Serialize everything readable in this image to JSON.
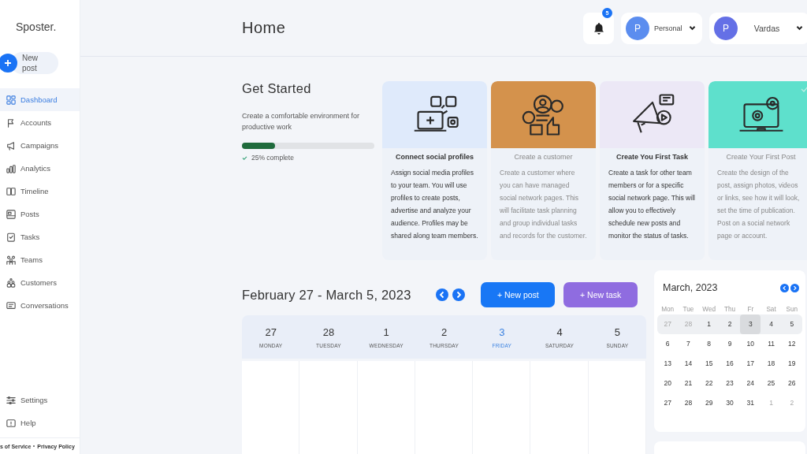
{
  "brand": "Sposter.",
  "new_post": "New post",
  "nav": [
    {
      "label": "Dashboard",
      "selected": true
    },
    {
      "label": "Accounts",
      "selected": false
    },
    {
      "label": "Campaigns",
      "selected": false
    },
    {
      "label": "Analytics",
      "selected": false
    },
    {
      "label": "Timeline",
      "selected": false
    },
    {
      "label": "Posts",
      "selected": false
    },
    {
      "label": "Tasks",
      "selected": false
    },
    {
      "label": "Teams",
      "selected": false
    },
    {
      "label": "Customers",
      "selected": false
    },
    {
      "label": "Conversations",
      "selected": false
    }
  ],
  "nav_bottom": [
    {
      "label": "Settings",
      "selected": false
    },
    {
      "label": "Help",
      "selected": false
    }
  ],
  "footer_links": [
    "s of Service",
    "Privacy Policy"
  ],
  "page_title": "Home",
  "notifications": {
    "count": "5"
  },
  "accounts": [
    {
      "avatar": "P",
      "label": "Personal",
      "color": "#5b8def"
    },
    {
      "avatar": "P",
      "label": "Vardas",
      "color": "#6470e6"
    }
  ],
  "get_started": {
    "title": "Get Started",
    "subtitle": "Create a comfortable environment for productive work",
    "level": 0.25,
    "progress_text": "25% complete"
  },
  "cards": [
    {
      "title": "Connect social profiles",
      "text": "Assign social media profiles to your team. You will use profiles to create posts, advertise and analyze your audience. Profiles may be shared along team members.",
      "color": "#dfeafb",
      "dimmed": false,
      "checked": false
    },
    {
      "title": "Create a customer",
      "text": "Create a customer where you can have managed social network pages. This will facilitate task planning and group individual tasks and records for the customer.",
      "color": "#d4924c",
      "dimmed": true,
      "checked": false
    },
    {
      "title": "Create You First Task",
      "text": "Create a task for other team members or for a specific social network page. This will allow you to effectively schedule new posts and monitor the status of tasks.",
      "color": "#ece8f6",
      "dimmed": false,
      "checked": false
    },
    {
      "title": "Create Your First Post",
      "text": "Create the design of the post, assign photos, videos or links, see how it will look, set the time of publication. Post on a social network page or account.",
      "color": "#5ee0cc",
      "dimmed": true,
      "checked": true
    }
  ],
  "week": {
    "title": "February 27 - March 5, 2023",
    "buttons": [
      {
        "label": "+ New post",
        "color": "#1877f5"
      },
      {
        "label": "+ New task",
        "color": "#8f6ce0"
      }
    ],
    "days": [
      {
        "date": "27",
        "weekday": "MONDAY",
        "selected": false
      },
      {
        "date": "28",
        "weekday": "TUESDAY",
        "selected": false
      },
      {
        "date": "1",
        "weekday": "WEDNESDAY",
        "selected": false
      },
      {
        "date": "2",
        "weekday": "THURSDAY",
        "selected": false
      },
      {
        "date": "3",
        "weekday": "FRIDAY",
        "selected": true
      },
      {
        "date": "4",
        "weekday": "SATURDAY",
        "selected": false
      },
      {
        "date": "5",
        "weekday": "SUNDAY",
        "selected": false
      }
    ]
  },
  "mini_calendar": {
    "title": "March, 2023",
    "weekdays": [
      "Mon",
      "Tue",
      "Wed",
      "Thu",
      "Fr",
      "Sat",
      "Sun"
    ],
    "weeks": [
      {
        "current": true,
        "days": [
          {
            "day": "27",
            "muted": true,
            "selected": false
          },
          {
            "day": "28",
            "muted": true,
            "selected": false
          },
          {
            "day": "1",
            "muted": false,
            "selected": false
          },
          {
            "day": "2",
            "muted": false,
            "selected": false
          },
          {
            "day": "3",
            "muted": false,
            "selected": true
          },
          {
            "day": "4",
            "muted": false,
            "selected": false
          },
          {
            "day": "5",
            "muted": false,
            "selected": false
          }
        ]
      },
      {
        "current": false,
        "days": [
          {
            "day": "6",
            "muted": false,
            "selected": false
          },
          {
            "day": "7",
            "muted": false,
            "selected": false
          },
          {
            "day": "8",
            "muted": false,
            "selected": false
          },
          {
            "day": "9",
            "muted": false,
            "selected": false
          },
          {
            "day": "10",
            "muted": false,
            "selected": false
          },
          {
            "day": "11",
            "muted": false,
            "selected": false
          },
          {
            "day": "12",
            "muted": false,
            "selected": false
          }
        ]
      },
      {
        "current": false,
        "days": [
          {
            "day": "13",
            "muted": false,
            "selected": false
          },
          {
            "day": "14",
            "muted": false,
            "selected": false
          },
          {
            "day": "15",
            "muted": false,
            "selected": false
          },
          {
            "day": "16",
            "muted": false,
            "selected": false
          },
          {
            "day": "17",
            "muted": false,
            "selected": false
          },
          {
            "day": "18",
            "muted": false,
            "selected": false
          },
          {
            "day": "19",
            "muted": false,
            "selected": false
          }
        ]
      },
      {
        "current": false,
        "days": [
          {
            "day": "20",
            "muted": false,
            "selected": false
          },
          {
            "day": "21",
            "muted": false,
            "selected": false
          },
          {
            "day": "22",
            "muted": false,
            "selected": false
          },
          {
            "day": "23",
            "muted": false,
            "selected": false
          },
          {
            "day": "24",
            "muted": false,
            "selected": false
          },
          {
            "day": "25",
            "muted": false,
            "selected": false
          },
          {
            "day": "26",
            "muted": false,
            "selected": false
          }
        ]
      },
      {
        "current": false,
        "days": [
          {
            "day": "27",
            "muted": false,
            "selected": false
          },
          {
            "day": "28",
            "muted": false,
            "selected": false
          },
          {
            "day": "29",
            "muted": false,
            "selected": false
          },
          {
            "day": "30",
            "muted": false,
            "selected": false
          },
          {
            "day": "31",
            "muted": false,
            "selected": false
          },
          {
            "day": "1",
            "muted": true,
            "selected": false
          },
          {
            "day": "2",
            "muted": true,
            "selected": false
          }
        ]
      }
    ]
  }
}
